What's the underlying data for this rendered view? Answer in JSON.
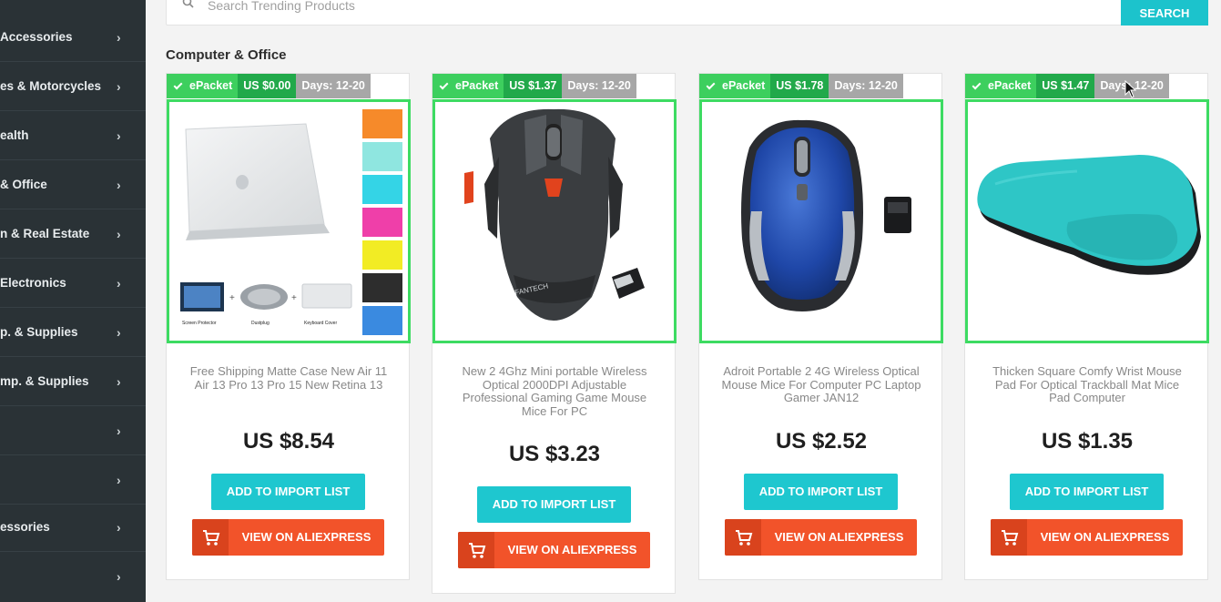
{
  "sidebar": {
    "items": [
      {
        "label": "Accessories"
      },
      {
        "label": "es & Motorcycles"
      },
      {
        "label": "ealth"
      },
      {
        "label": "& Office"
      },
      {
        "label": "n & Real Estate"
      },
      {
        "label": "Electronics"
      },
      {
        "label": "p. & Supplies"
      },
      {
        "label": "mp. & Supplies"
      },
      {
        "label": ""
      },
      {
        "label": ""
      },
      {
        "label": "essories"
      },
      {
        "label": ""
      }
    ],
    "chevron": "›"
  },
  "search": {
    "placeholder": "Search Trending Products",
    "button_label": "SEARCH"
  },
  "section_title": "Computer & Office",
  "products": [
    {
      "shipping": "ePacket",
      "shipping_price": "US $0.00",
      "days": "Days: 12-20",
      "title": "Free Shipping Matte Case New Air 11 Air 13 Pro 13 Pro 15 New Retina 13",
      "price": "US $8.54",
      "import_label": "ADD TO IMPORT LIST",
      "ali_label": "VIEW ON ALIEXPRESS",
      "image": {
        "type": "laptop-case",
        "swatches": [
          "#f68a2a",
          "#8fe6e0",
          "#34d4e6",
          "#ef3fa9",
          "#f2ec24",
          "#2d2d2d",
          "#3a8ae0"
        ],
        "captions": [
          "Screen Protector",
          "Dustplug",
          "Keyboard Cover"
        ]
      }
    },
    {
      "shipping": "ePacket",
      "shipping_price": "US $1.37",
      "days": "Days: 12-20",
      "title": "New 2 4Ghz Mini portable Wireless Optical 2000DPI Adjustable Professional Gaming Game Mouse Mice For PC",
      "price": "US $3.23",
      "import_label": "ADD TO IMPORT LIST",
      "ali_label": "VIEW ON ALIEXPRESS",
      "image": {
        "type": "gaming-mouse",
        "logo_text": "FANTECH"
      }
    },
    {
      "shipping": "ePacket",
      "shipping_price": "US $1.78",
      "days": "Days: 12-20",
      "title": "Adroit Portable 2 4G Wireless Optical Mouse Mice For Computer PC Laptop Gamer JAN12",
      "price": "US $2.52",
      "import_label": "ADD TO IMPORT LIST",
      "ali_label": "VIEW ON ALIEXPRESS",
      "image": {
        "type": "blue-mouse"
      }
    },
    {
      "shipping": "ePacket",
      "shipping_price": "US $1.47",
      "days": "Days: 12-20",
      "title": "Thicken Square Comfy Wrist Mouse Pad For Optical Trackball Mat Mice Pad Computer",
      "price": "US $1.35",
      "import_label": "ADD TO IMPORT LIST",
      "ali_label": "VIEW ON ALIEXPRESS",
      "image": {
        "type": "mouse-pad"
      }
    }
  ],
  "colors": {
    "sidebar_bg": "#2a3236",
    "accent_teal": "#1ec7cf",
    "aliexpress_orange": "#f2532a",
    "epacket_green": "#3dcf5e",
    "frame_green": "#3ddb62"
  }
}
